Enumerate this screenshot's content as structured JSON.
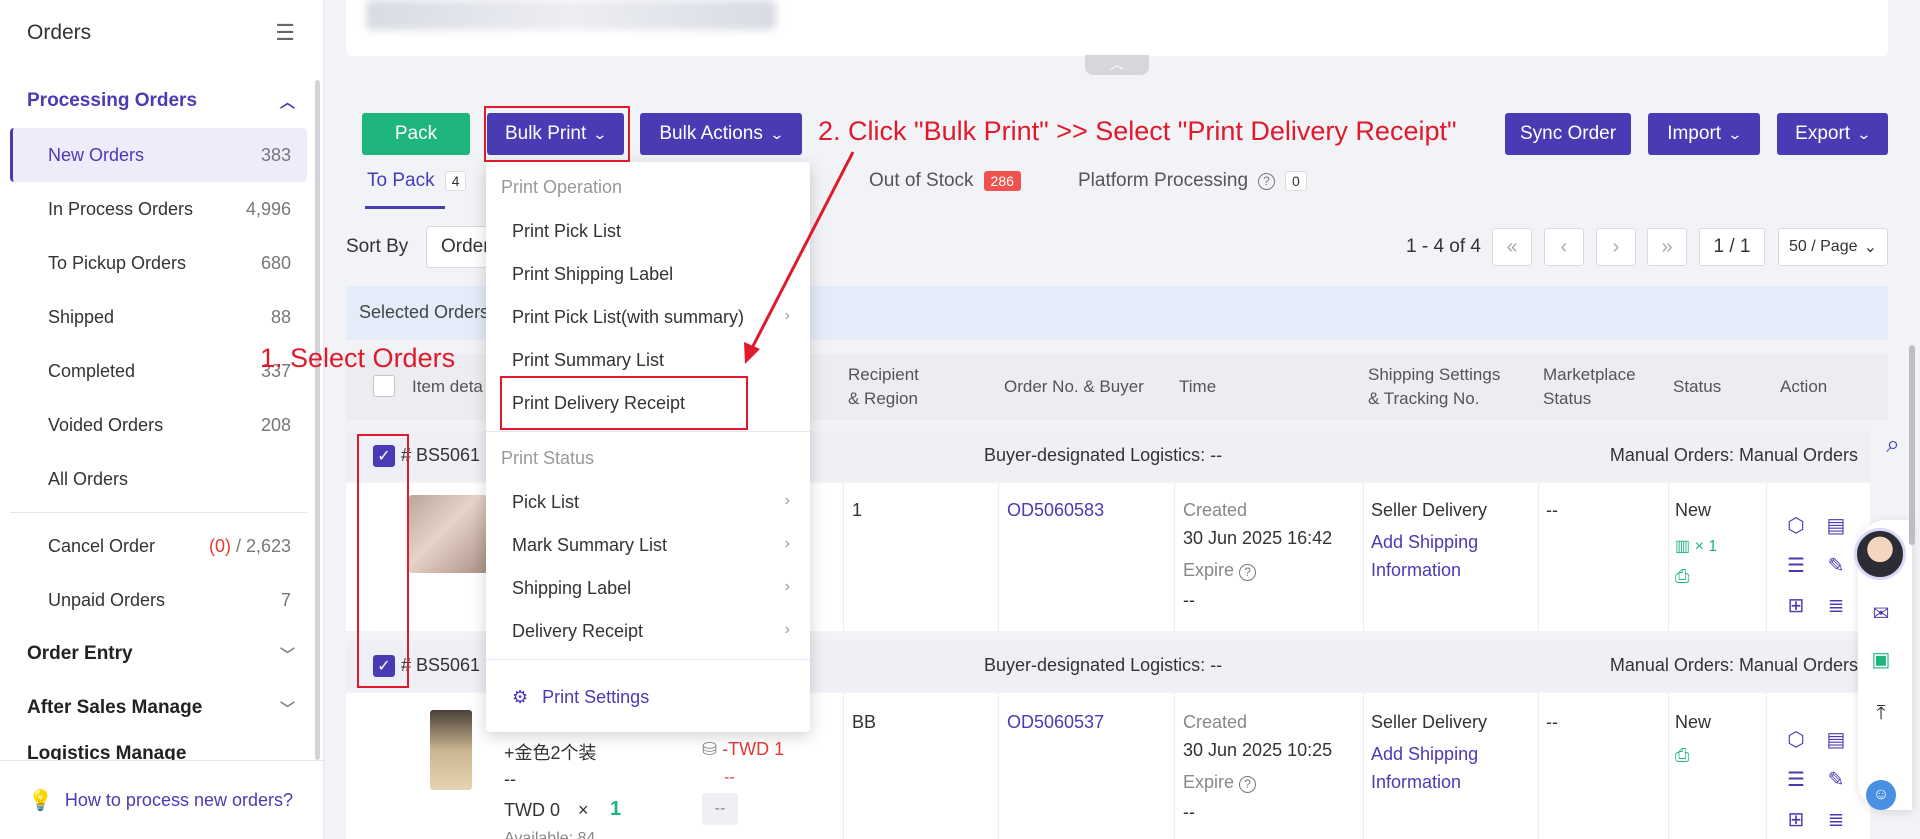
{
  "sidebar": {
    "title": "Orders",
    "processing_group": "Processing Orders",
    "items": [
      {
        "label": "New Orders",
        "count": "383"
      },
      {
        "label": "In Process Orders",
        "count": "4,996"
      },
      {
        "label": "To Pickup Orders",
        "count": "680"
      },
      {
        "label": "Shipped",
        "count": "88"
      },
      {
        "label": "Completed",
        "count": "337"
      },
      {
        "label": "Voided Orders",
        "count": "208"
      },
      {
        "label": "All Orders",
        "count": ""
      }
    ],
    "cancel_label": "Cancel Order",
    "cancel_count_red": "(0)",
    "cancel_count_rest": " / 2,623",
    "unpaid_label": "Unpaid Orders",
    "unpaid_count": "7",
    "order_entry": "Order Entry",
    "after_sales": "After Sales Manage",
    "logistics": "Logistics Manage",
    "help_link": "How to process new orders?"
  },
  "toolbar": {
    "pack": "Pack",
    "bulk_print": "Bulk Print",
    "bulk_actions": "Bulk Actions",
    "sync_order": "Sync Order",
    "import": "Import",
    "export": "Export"
  },
  "tabs": {
    "to_pack": "To Pack",
    "to_pack_count": "4",
    "out_of_stock": "Out of Stock",
    "out_of_stock_count": "286",
    "platform_processing": "Platform Processing",
    "platform_processing_count": "0"
  },
  "sort": {
    "label": "Sort By",
    "value": "Order"
  },
  "pager": {
    "range": "1 - 4 of 4",
    "page": "1 / 1",
    "page_size": "50 / Page"
  },
  "selected_bar": "Selected Orders",
  "table_headers": {
    "item": "Item deta",
    "recipient": [
      "Recipient",
      "& Region"
    ],
    "order_no": "Order No. & Buyer",
    "time": "Time",
    "shipping": [
      "Shipping Settings",
      "& Tracking No."
    ],
    "marketplace": [
      "Marketplace",
      "Status"
    ],
    "status": "Status",
    "action": "Action"
  },
  "orders": [
    {
      "id": "# BS5061",
      "logistics": "Buyer-designated Logistics: --",
      "manual": "Manual Orders: Manual Orders",
      "recipient": "1",
      "order_no": "OD5060583",
      "created_label": "Created",
      "created": "30 Jun 2025 16:42",
      "expire_label": "Expire",
      "expire": "--",
      "ship_method": "Seller Delivery",
      "ship_link": [
        "Add Shipping",
        "Information"
      ],
      "marketplace_status": "--",
      "status": "New",
      "status_qty": "× 1"
    },
    {
      "id": "# BS5061",
      "logistics": "Buyer-designated Logistics: --",
      "manual": "Manual Orders: Manual Orders",
      "item_name": "+金色2个装",
      "item_dash": "--",
      "item_price": "TWD 0",
      "item_times": "×",
      "item_qty": "1",
      "item_available": "Available: 84",
      "amount": "-TWD 1",
      "amount_dash": "--",
      "amount_box": "--",
      "recipient": "BB",
      "order_no": "OD5060537",
      "created_label": "Created",
      "created": "30 Jun 2025 10:25",
      "expire_label": "Expire",
      "expire": "--",
      "ship_method": "Seller Delivery",
      "ship_link": [
        "Add Shipping",
        "Information"
      ],
      "marketplace_status": "--",
      "status": "New"
    }
  ],
  "dropdown": {
    "section1": "Print Operation",
    "items1": [
      "Print Pick List",
      "Print Shipping Label",
      "Print Pick List(with summary)",
      "Print Summary List",
      "Print Delivery Receipt"
    ],
    "section2": "Print Status",
    "items2": [
      "Pick List",
      "Mark Summary List",
      "Shipping Label",
      "Delivery Receipt"
    ],
    "settings": "Print Settings"
  },
  "annotations": {
    "step1": "1. Select Orders",
    "step2": "2. Click \"Bulk Print\" >> Select \"Print Delivery Receipt\""
  },
  "colors": {
    "primary": "#4a3bb5",
    "green": "#1fb57f",
    "annotation_red": "#e0192b",
    "danger": "#e53935"
  }
}
